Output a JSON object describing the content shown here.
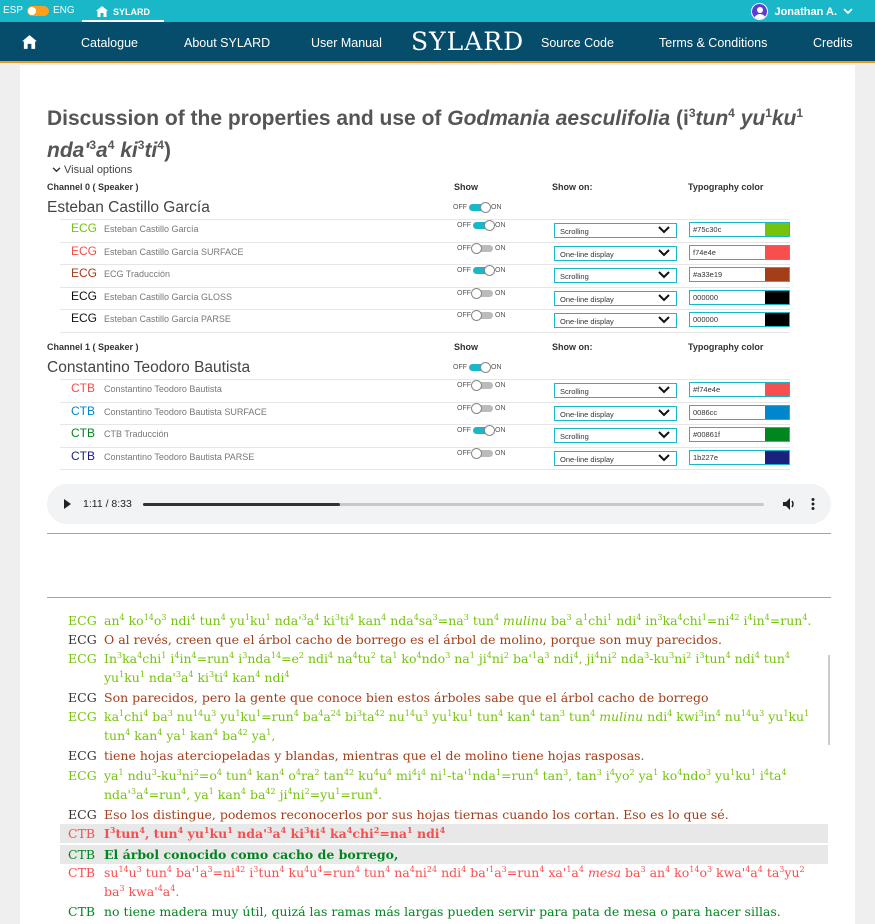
{
  "topbar": {
    "lang_left": "ESP",
    "lang_right": "ENG",
    "home_tab": "SYLARD",
    "user_name": "Jonathan A."
  },
  "nav": {
    "items": [
      "Catalogue",
      "About SYLARD",
      "User Manual",
      "Source Code",
      "Terms & Conditions",
      "Credits"
    ],
    "brand": "SYLARD"
  },
  "page": {
    "title_a": "Discussion of the properties and use of ",
    "title_species": "Godmania aesculifolia",
    "title_b": " (i",
    "title_sup1": "3",
    "title_c": "tun",
    "title_sup2": "4",
    "title_d": " yu",
    "title_sup3": "1",
    "title_e": "ku",
    "title_sup4": "1",
    "title_f": " nda'",
    "title_sup5": "3",
    "title_g": "a",
    "title_sup6": "4",
    "title_h": " ki",
    "title_sup7": "3",
    "title_i": "ti",
    "title_sup8": "4",
    "title_j": ")",
    "visual_options": "Visual options"
  },
  "labels": {
    "show": "Show",
    "show_on": "Show on:",
    "typography_color": "Typography color",
    "off": "OFF",
    "on": "ON"
  },
  "channels": [
    {
      "channel_label": "Channel 0 ( Speaker )",
      "speaker": "Esteban Castillo García",
      "show": true,
      "tiers": [
        {
          "code": "ECG",
          "name": "Esteban Castillo García",
          "on": true,
          "show_on": "Scrolling",
          "color_text": "#75c30c",
          "color": "#75c30c"
        },
        {
          "code": "ECG",
          "name": "Esteban Castillo García SURFACE",
          "on": false,
          "show_on": "One-line display",
          "color_text": "f74e4e",
          "color": "#f74e4e"
        },
        {
          "code": "ECG",
          "name": "ECG Traducción",
          "on": true,
          "show_on": "Scrolling",
          "color_text": "#a33e19",
          "color": "#a33e19"
        },
        {
          "code": "ECG",
          "name": "Esteban Castillo García GLOSS",
          "on": false,
          "show_on": "One-line display",
          "color_text": "000000",
          "color": "#000000"
        },
        {
          "code": "ECG",
          "name": "Esteban Castillo García PARSE",
          "on": false,
          "show_on": "One-line display",
          "color_text": "000000",
          "color": "#000000"
        }
      ]
    },
    {
      "channel_label": "Channel 1 ( Speaker )",
      "speaker": "Constantino Teodoro Bautista",
      "show": true,
      "tiers": [
        {
          "code": "CTB",
          "name": "Constantino Teodoro Bautista",
          "on": false,
          "show_on": "Scrolling",
          "color_text": "#f74e4e",
          "color": "#f74e4e"
        },
        {
          "code": "CTB",
          "name": "Constantino Teodoro Bautista SURFACE",
          "on": false,
          "show_on": "One-line display",
          "color_text": "0086cc",
          "color": "#0086cc"
        },
        {
          "code": "CTB",
          "name": "CTB Traducción",
          "on": true,
          "show_on": "Scrolling",
          "color_text": "#00861f",
          "color": "#00861f"
        },
        {
          "code": "CTB",
          "name": "Constantino Teodoro Bautista PARSE",
          "on": false,
          "show_on": "One-line display",
          "color_text": "1b227e",
          "color": "#1b227e"
        }
      ]
    }
  ],
  "audio": {
    "time": "1:11 / 8:33",
    "progress": 0.318
  },
  "transcript": [
    {
      "code": "ECG",
      "color": "#75c30c",
      "html": "an<sup>4</sup> ko<sup>14</sup>o<sup>3</sup> ndi<sup>4</sup> tun<sup>4</sup> yu<sup>1</sup>ku<sup>1</sup> nda'<sup>3</sup>a<sup>4</sup> ki<sup>3</sup>ti<sup>4</sup> kan<sup>4</sup> nda<sup>4</sup>sa<sup>3</sup>=na<sup>3</sup> tun<sup>4</sup> <i>mulinu</i> ba<sup>3</sup> a<sup>1</sup>chi<sup>1</sup> ndi<sup>4</sup> in<sup>3</sup>ka<sup>4</sup>chi<sup>1</sup>=ni<sup>42</sup> i<sup>4</sup>in<sup>4</sup>=run<sup>4</sup>.",
      "hl": false
    },
    {
      "code": "ECG",
      "color": "#a33e19",
      "text": "O al revés, creen que el árbol cacho de borrego es el árbol de molino, porque son muy parecidos.",
      "hl": false
    },
    {
      "code": "ECG",
      "color": "#75c30c",
      "html": "In<sup>3</sup>ka<sup>4</sup>chi<sup>1</sup> i<sup>4</sup>in<sup>4</sup>=run<sup>4</sup> i<sup>3</sup>nda<sup>14</sup>=e<sup>2</sup> ndi<sup>4</sup> na<sup>4</sup>tu<sup>2</sup> ta<sup>1</sup> ko<sup>4</sup>ndo<sup>3</sup> na<sup>1</sup> ji<sup>4</sup>ni<sup>2</sup> ba'<sup>1</sup>a<sup>3</sup> ndi<sup>4</sup>, ji<sup>4</sup>ni<sup>2</sup> nda<sup>3</sup>-ku<sup>3</sup>ni<sup>2</sup> i<sup>3</sup>tun<sup>4</sup> ndi<sup>4</sup> tun<sup>4</sup> yu<sup>1</sup>ku<sup>1</sup> nda'<sup>3</sup>a<sup>4</sup> ki<sup>3</sup>ti<sup>4</sup> kan<sup>4</sup> ndi<sup>4</sup>",
      "hl": false
    },
    {
      "code": "ECG",
      "color": "#a33e19",
      "text": "Son parecidos, pero la gente que conoce bien estos árboles sabe que el árbol cacho de borrego",
      "hl": false
    },
    {
      "code": "ECG",
      "color": "#75c30c",
      "html": "ka<sup>1</sup>chi<sup>4</sup> ba<sup>3</sup> nu<sup>14</sup>u<sup>3</sup> yu<sup>1</sup>ku<sup>1</sup>=run<sup>4</sup> ba<sup>4</sup>a<sup>24</sup> bi<sup>3</sup>ta<sup>42</sup> nu<sup>14</sup>u<sup>3</sup> yu<sup>1</sup>ku<sup>1</sup> tun<sup>4</sup> kan<sup>4</sup> tan<sup>3</sup> tun<sup>4</sup> <i>mulinu</i> ndi<sup>4</sup> kwi<sup>3</sup>in<sup>4</sup> nu<sup>14</sup>u<sup>3</sup> yu<sup>1</sup>ku<sup>1</sup> tun<sup>4</sup> kan<sup>4</sup> ya<sup>1</sup> kan<sup>4</sup> ba<sup>42</sup> ya<sup>1</sup>,",
      "hl": false
    },
    {
      "code": "ECG",
      "color": "#a33e19",
      "text": "tiene hojas aterciopeladas y blandas, mientras que el de molino tiene hojas rasposas.",
      "hl": false
    },
    {
      "code": "ECG",
      "color": "#75c30c",
      "html": "ya<sup>1</sup> ndu<sup>3</sup>-ku<sup>3</sup>ni<sup>2</sup>=o<sup>4</sup> tun<sup>4</sup> kan<sup>4</sup> o<sup>4</sup>ra<sup>2</sup> tan<sup>42</sup> ku<sup>4</sup>u<sup>4</sup> mi<sup>4</sup>i<sup>4</sup> ni<sup>1</sup>-ta'<sup>1</sup>nda<sup>1</sup>=run<sup>4</sup> tan<sup>3</sup>, tan<sup>3</sup> i<sup>4</sup>yo<sup>2</sup> ya<sup>1</sup> ko<sup>4</sup>ndo<sup>3</sup> yu<sup>1</sup>ku<sup>1</sup> i<sup>4</sup>ta<sup>4</sup> nda'<sup>3</sup>a<sup>4</sup>=run<sup>4</sup>, ya<sup>1</sup> kan<sup>4</sup> ba<sup>42</sup> ji<sup>4</sup>ni<sup>2</sup>=yu<sup>1</sup>=run<sup>4</sup>.",
      "hl": false
    },
    {
      "code": "ECG",
      "color": "#a33e19",
      "text": "Eso los distingue, podemos reconocerlos por sus hojas tiernas cuando los cortan. Eso es lo que sé.",
      "hl": false
    },
    {
      "code": "CTB",
      "color": "#f74e4e",
      "html": "<b>I<sup>3</sup>tun<sup>4</sup>, tun<sup>4</sup> yu<sup>1</sup>ku<sup>1</sup> nda'<sup>3</sup>a<sup>4</sup> ki<sup>3</sup>ti<sup>4</sup> ka<sup>4</sup>chi<sup>2</sup>=na<sup>1</sup> ndi<sup>4</sup></b>",
      "hl": true
    },
    {
      "code": "CTB",
      "color": "#00861f",
      "text": "El árbol conocido como cacho de borrego,",
      "bold": true,
      "hl": true
    },
    {
      "code": "CTB",
      "color": "#f74e4e",
      "html": "su<sup>14</sup>u<sup>3</sup> tun<sup>4</sup> ba'<sup>1</sup>a<sup>3</sup>=ni<sup>42</sup> i<sup>3</sup>tun<sup>4</sup> ku<sup>4</sup>u<sup>4</sup>=run<sup>4</sup> tun<sup>4</sup> na<sup>4</sup>ni<sup>24</sup> ndi<sup>4</sup> ba'<sup>1</sup>a<sup>3</sup>=run<sup>4</sup> xa'<sup>1</sup>a<sup>4</sup> <i>mesa</i> ba<sup>3</sup> an<sup>4</sup> ko<sup>14</sup>o<sup>3</sup> kwa'<sup>4</sup>a<sup>4</sup> ta<sup>3</sup>yu<sup>2</sup> ba<sup>3</sup> kwa'<sup>4</sup>a<sup>4</sup>.",
      "hl": false
    },
    {
      "code": "CTB",
      "color": "#00861f",
      "text": "no tiene madera muy útil, quizá las ramas más largas pueden servir para pata de mesa o para hacer sillas.",
      "hl": false
    }
  ]
}
